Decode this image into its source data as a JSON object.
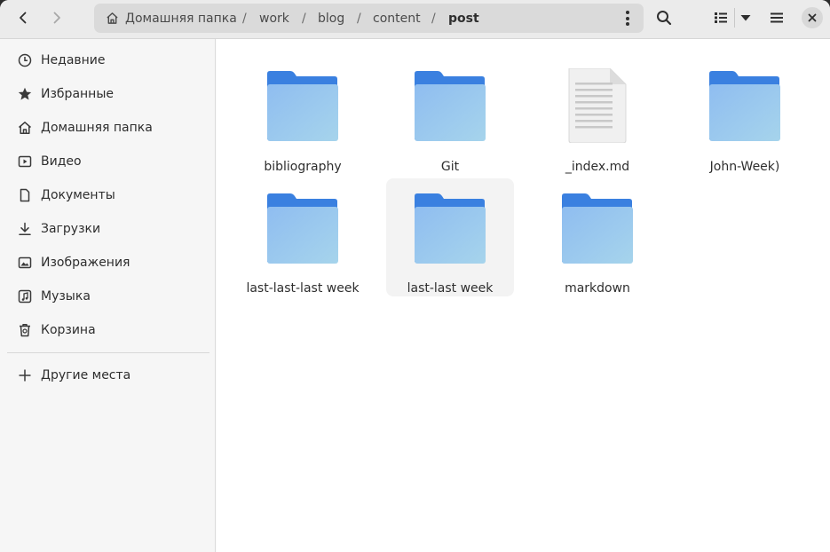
{
  "headerbar": {
    "breadcrumbs": [
      {
        "label": "Домашняя папка",
        "current": false
      },
      {
        "label": "work",
        "current": false
      },
      {
        "label": "blog",
        "current": false
      },
      {
        "label": "content",
        "current": false
      },
      {
        "label": "post",
        "current": true
      }
    ],
    "separator": "/"
  },
  "sidebar": {
    "items": [
      {
        "label": "Недавние",
        "icon": "clock-icon"
      },
      {
        "label": "Избранные",
        "icon": "star-icon"
      },
      {
        "label": "Домашняя папка",
        "icon": "home-icon"
      },
      {
        "label": "Видео",
        "icon": "video-icon"
      },
      {
        "label": "Документы",
        "icon": "document-icon"
      },
      {
        "label": "Загрузки",
        "icon": "download-icon"
      },
      {
        "label": "Изображения",
        "icon": "image-icon"
      },
      {
        "label": "Музыка",
        "icon": "music-icon"
      },
      {
        "label": "Корзина",
        "icon": "trash-icon"
      }
    ],
    "other_places": "Другие места"
  },
  "files": [
    {
      "name": "bibliography",
      "type": "folder"
    },
    {
      "name": "Git",
      "type": "folder"
    },
    {
      "name": "_index.md",
      "type": "text"
    },
    {
      "name": "John-Week)",
      "type": "folder"
    },
    {
      "name": "last-last-last week",
      "type": "folder"
    },
    {
      "name": "last-last week",
      "type": "folder"
    },
    {
      "name": "markdown",
      "type": "folder"
    }
  ],
  "colors": {
    "folder_back": "#3a80e0",
    "folder_front_top": "#8fbdf0",
    "folder_front_bottom": "#a6d4ec"
  }
}
